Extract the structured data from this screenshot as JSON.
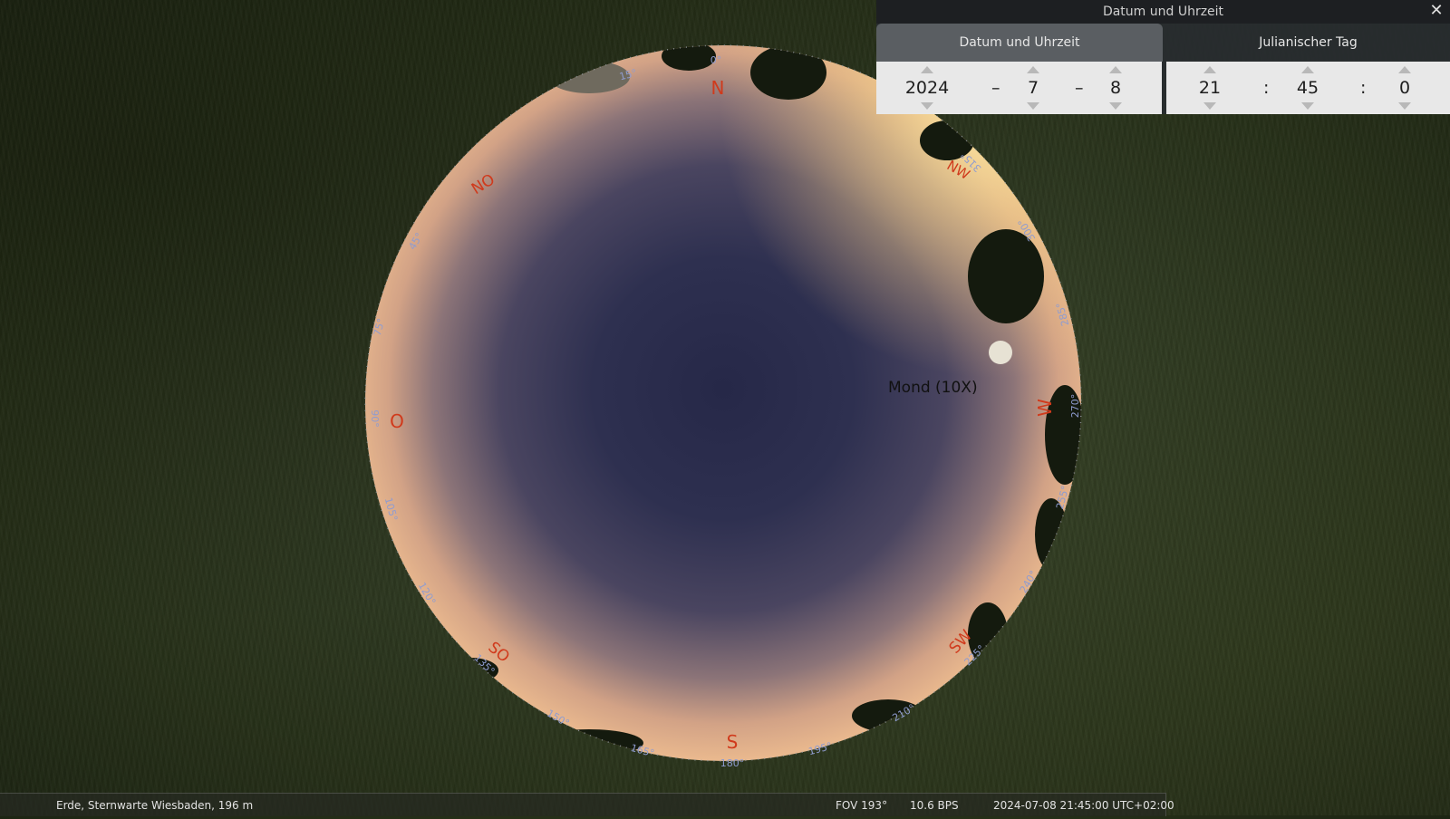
{
  "dialog": {
    "title": "Datum und Uhrzeit",
    "tabs": [
      "Datum und Uhrzeit",
      "Julianischer Tag"
    ],
    "date": {
      "year": "2024",
      "month": "7",
      "day": "8",
      "separator": "–"
    },
    "time": {
      "hour": "21",
      "minute": "45",
      "second": "0",
      "separator": ":"
    }
  },
  "sky": {
    "cardinals": {
      "north": "N",
      "northeast": "NO",
      "east": "O",
      "southeast": "SO",
      "south": "S",
      "southwest": "SW",
      "west": "W",
      "northwest": "NW"
    },
    "azimuth_labels": [
      "0°",
      "15°",
      "45°",
      "75°",
      "90°",
      "105°",
      "120°",
      "135°",
      "150°",
      "165°",
      "180°",
      "195°",
      "210°",
      "225°",
      "240°",
      "255°",
      "270°",
      "285°",
      "300°",
      "315°"
    ],
    "moon_label": "Mond (10X)"
  },
  "statusbar": {
    "location": "Erde, Sternwarte Wiesbaden, 196 m",
    "fov": "FOV 193°",
    "fps": "10.6 BPS",
    "datetime": "2024-07-08 21:45:00 UTC+02:00"
  },
  "colors": {
    "cardinal": "#d03a1c",
    "azimuth": "#8f9cd0",
    "sky_center": "#2a2c4a",
    "sky_horizon": "#e6b48a"
  }
}
